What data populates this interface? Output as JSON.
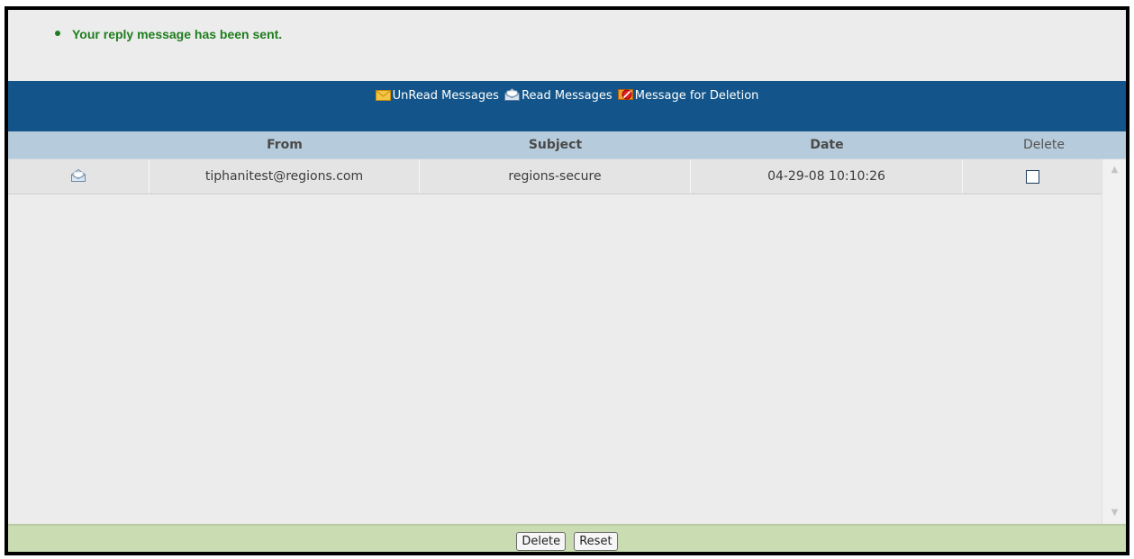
{
  "notice": {
    "message": "Your reply message has been sent.",
    "color": "#1e7d1e"
  },
  "nav": {
    "unread": {
      "label": "UnRead Messages",
      "icon": "closed-envelope-icon"
    },
    "read": {
      "label": "Read Messages",
      "icon": "open-envelope-icon"
    },
    "deletion": {
      "label": "Message for Deletion",
      "icon": "delete-mark-icon"
    },
    "background": "#13558a"
  },
  "table": {
    "headers": {
      "from": "From",
      "subject": "Subject",
      "date": "Date",
      "delete": "Delete"
    },
    "rows": [
      {
        "icon": "open-envelope-icon",
        "from": "tiphanitest@regions.com",
        "subject": "regions-secure",
        "date": "04-29-08 10:10:26",
        "delete_checked": false
      }
    ]
  },
  "footer": {
    "delete_label": "Delete",
    "reset_label": "Reset",
    "background": "#c9dcb2"
  }
}
